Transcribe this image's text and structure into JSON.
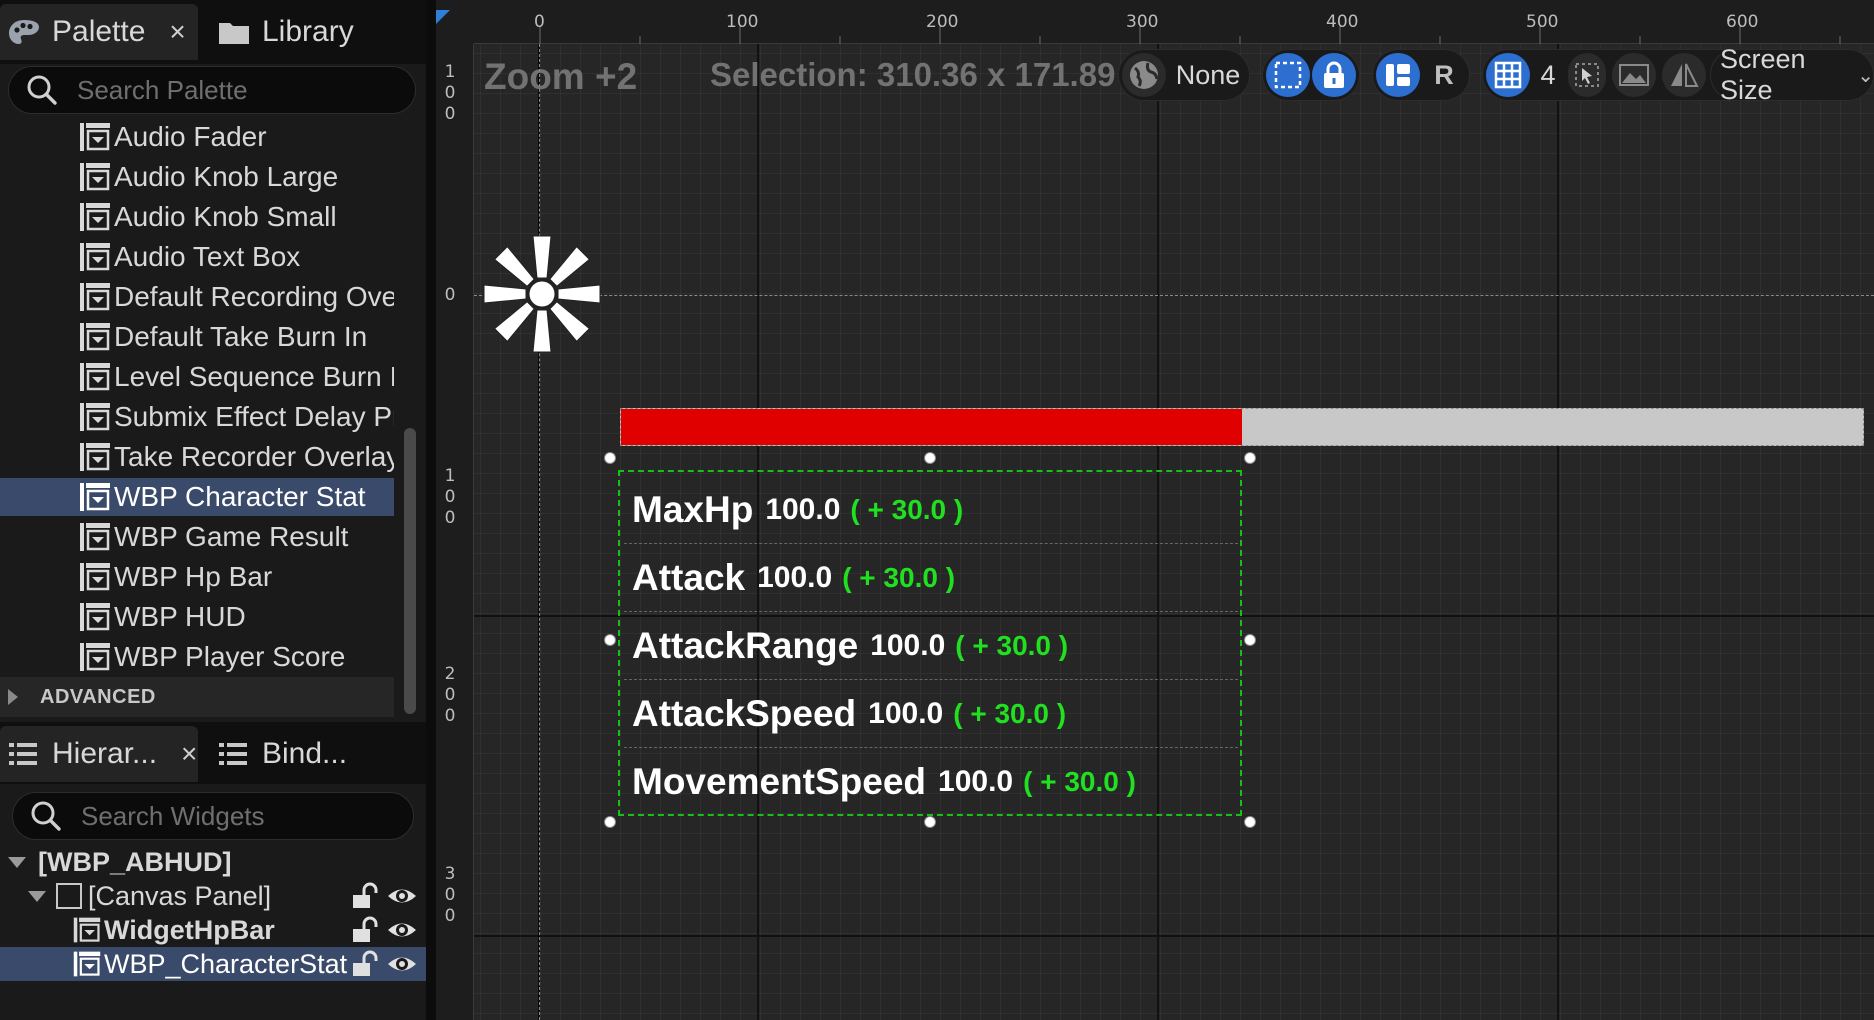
{
  "palette_tab": {
    "label": "Palette",
    "close": "×"
  },
  "library_tab": {
    "label": "Library"
  },
  "palette_search": {
    "placeholder": "Search Palette"
  },
  "palette_items": [
    "Audio Fader",
    "Audio Knob Large",
    "Audio Knob Small",
    "Audio Text Box",
    "Default Recording Overl",
    "Default Take Burn In",
    "Level Sequence Burn In",
    "Submix Effect Delay Pr",
    "Take Recorder Overlay \\",
    "WBP Character Stat",
    "WBP Game Result",
    "WBP Hp Bar",
    "WBP HUD",
    "WBP Player Score"
  ],
  "advanced_label": "ADVANCED",
  "hierarchy_tab": {
    "label": "Hierar...",
    "close": "×"
  },
  "bind_tab": {
    "label": "Bind..."
  },
  "widget_search": {
    "placeholder": "Search Widgets"
  },
  "tree": {
    "root": "[WBP_ABHUD]",
    "canvas": "[Canvas Panel]",
    "hpbar": "WidgetHpBar",
    "charstat": "WBP_CharacterStat"
  },
  "ruler": {
    "top_labels": [
      "0",
      "100",
      "200",
      "300",
      "400",
      "500",
      "600"
    ],
    "left_labels": [
      [
        "1",
        "0",
        "0"
      ],
      [
        "0"
      ],
      [
        "1",
        "0",
        "0"
      ],
      [
        "2",
        "0",
        "0"
      ],
      [
        "3",
        "0",
        "0"
      ]
    ]
  },
  "toolbar": {
    "zoom": "Zoom +2",
    "selection": "Selection: 310.36 x 171.89",
    "localization": "None",
    "r_label": "R",
    "grid_value": "4",
    "screen_size": "Screen Size"
  },
  "hp_bar": {
    "percent": 0.5
  },
  "stats": [
    {
      "name": "MaxHp",
      "value": "100.0",
      "bonus": "( + 30.0 )"
    },
    {
      "name": "Attack",
      "value": "100.0",
      "bonus": "( + 30.0 )"
    },
    {
      "name": "AttackRange",
      "value": "100.0",
      "bonus": "( + 30.0 )"
    },
    {
      "name": "AttackSpeed",
      "value": "100.0",
      "bonus": "( + 30.0 )"
    },
    {
      "name": "MovementSpeed",
      "value": "100.0",
      "bonus": "( + 30.0 )"
    }
  ],
  "colors": {
    "selection_blue": "#3a4a6a",
    "accent_blue": "#2d6fd0",
    "hp_red": "#e00000",
    "bonus_green": "#20e020"
  }
}
